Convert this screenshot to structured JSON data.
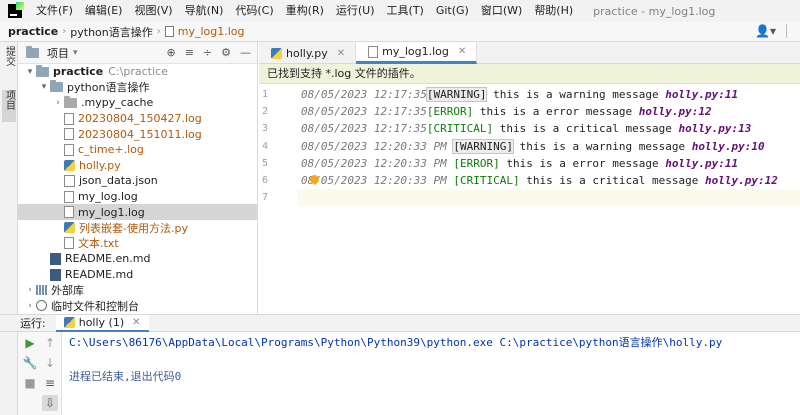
{
  "menubar": {
    "items": [
      "文件(F)",
      "编辑(E)",
      "视图(V)",
      "导航(N)",
      "代码(C)",
      "重构(R)",
      "运行(U)",
      "工具(T)",
      "Git(G)",
      "窗口(W)",
      "帮助(H)"
    ],
    "window_title": "practice - my_log1.log"
  },
  "navbar": {
    "crumbs": [
      "practice",
      "python语言操作",
      "my_log1.log"
    ]
  },
  "left_strip": {
    "tabs": [
      "提交",
      "项目"
    ]
  },
  "project_panel": {
    "title": "项目",
    "tree": [
      {
        "label": "practice",
        "extra": "C:\\practice",
        "depth": 0,
        "arrow": "▾",
        "icon": "folder"
      },
      {
        "label": "python语言操作",
        "depth": 1,
        "arrow": "▾",
        "icon": "folder"
      },
      {
        "label": ".mypy_cache",
        "depth": 2,
        "arrow": "›",
        "icon": "folder-gray"
      },
      {
        "label": "20230804_150427.log",
        "depth": 2,
        "arrow": "",
        "icon": "doc",
        "tone": "orange"
      },
      {
        "label": "20230804_151011.log",
        "depth": 2,
        "arrow": "",
        "icon": "doc",
        "tone": "orange"
      },
      {
        "label": "c_time+.log",
        "depth": 2,
        "arrow": "",
        "icon": "doc",
        "tone": "orange"
      },
      {
        "label": "holly.py",
        "depth": 2,
        "arrow": "",
        "icon": "py",
        "tone": "orange"
      },
      {
        "label": "json_data.json",
        "depth": 2,
        "arrow": "",
        "icon": "json"
      },
      {
        "label": "my_log.log",
        "depth": 2,
        "arrow": "",
        "icon": "doc"
      },
      {
        "label": "my_log1.log",
        "depth": 2,
        "arrow": "",
        "icon": "doc",
        "selected": true
      },
      {
        "label": "列表嵌套-使用方法.py",
        "depth": 2,
        "arrow": "",
        "icon": "py",
        "tone": "orange"
      },
      {
        "label": "文本.txt",
        "depth": 2,
        "arrow": "",
        "icon": "doc",
        "tone": "orange"
      },
      {
        "label": "README.en.md",
        "depth": 1,
        "arrow": "",
        "icon": "md"
      },
      {
        "label": "README.md",
        "depth": 1,
        "arrow": "",
        "icon": "md"
      },
      {
        "label": "外部库",
        "depth": 0,
        "arrow": "›",
        "icon": "lib"
      },
      {
        "label": "临时文件和控制台",
        "depth": 0,
        "arrow": "›",
        "icon": "scratch"
      }
    ]
  },
  "editor": {
    "tabs": [
      {
        "label": "holly.py",
        "active": false
      },
      {
        "label": "my_log1.log",
        "active": true
      }
    ],
    "banner": "已找到支持 *.log 文件的插件。",
    "line_numbers": [
      "1",
      "2",
      "3",
      "4",
      "5",
      "6",
      "7"
    ],
    "lines": [
      {
        "ts": "08/05/2023 12:17:35",
        "ampm": "",
        "level": "[WARNING]",
        "kind": "warn",
        "msg": " this is a warning message ",
        "src": "holly.py:11"
      },
      {
        "ts": "08/05/2023 12:17:35",
        "ampm": "",
        "level": "[ERROR]",
        "kind": "err",
        "msg": " this is a error message ",
        "src": "holly.py:12"
      },
      {
        "ts": "08/05/2023 12:17:35",
        "ampm": "",
        "level": "[CRITICAL]",
        "kind": "crit",
        "msg": " this is a critical message ",
        "src": "holly.py:13"
      },
      {
        "ts": "08/05/2023 12:20:33",
        "ampm": " PM ",
        "level": "[WARNING]",
        "kind": "warn",
        "msg": " this is a warning message ",
        "src": "holly.py:10"
      },
      {
        "ts": "08/05/2023 12:20:33",
        "ampm": " PM ",
        "level": "[ERROR]",
        "kind": "err",
        "msg": " this is a error message ",
        "src": "holly.py:11"
      },
      {
        "ts": "08/05/2023 12:20:33",
        "ampm": " PM ",
        "level": "[CRITICAL]",
        "kind": "crit",
        "msg": " this is a critical message ",
        "src": "holly.py:12"
      },
      {
        "ts": "",
        "ampm": "",
        "level": "",
        "kind": "",
        "msg": "",
        "src": ""
      }
    ]
  },
  "run_panel": {
    "label": "运行:",
    "tab_label": "holly (1)",
    "command": "C:\\Users\\86176\\AppData\\Local\\Programs\\Python\\Python39\\python.exe C:\\practice\\python语言操作\\holly.py",
    "exit_message": "进程已结束,退出代码0"
  }
}
